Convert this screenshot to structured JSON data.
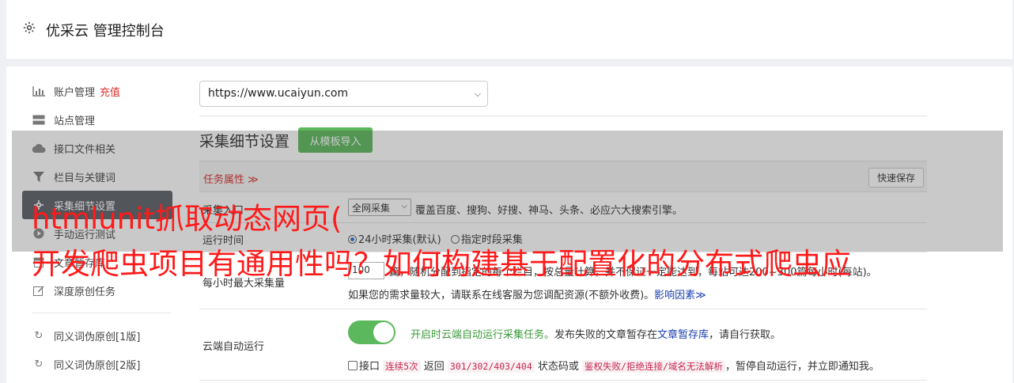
{
  "header": {
    "title": "优采云 管理控制台"
  },
  "sidebar": {
    "items": [
      {
        "label": "账户管理",
        "extra": "充值",
        "icon": "bar-chart-icon"
      },
      {
        "label": "站点管理",
        "icon": "server-icon"
      },
      {
        "label": "接口文件相关",
        "icon": "cloud-icon"
      },
      {
        "label": "栏目与关键词",
        "icon": "filter-icon"
      },
      {
        "label": "采集细节设置",
        "icon": "gear-icon",
        "active": true
      },
      {
        "label": "手动运行测试",
        "icon": "play-icon"
      },
      {
        "label": "文章暂存库",
        "icon": "archive-icon"
      },
      {
        "label": "深度原创任务",
        "icon": "edit-icon"
      },
      {
        "label": "同义词伪原创[1版]",
        "icon": "refresh-icon"
      },
      {
        "label": "同义词伪原创[2版]",
        "icon": "refresh-icon"
      }
    ]
  },
  "main": {
    "site_select": "https://www.ucaiyun.com",
    "section_title": "采集细节设置",
    "template_button": "从模板导入",
    "task_props": "任务属性 ≫",
    "quick_save": "快速保存",
    "source_label": "采集入口",
    "source_select": "全网采集",
    "source_desc": "覆盖百度、搜狗、好搜、神马、头条、必应六大搜索引擎。",
    "run_time_label": "运行时间",
    "run_time_opt1": "24小时采集(默认)",
    "run_time_opt2": "指定时段采集",
    "max_label": "每小时最大采集量",
    "max_value": "100",
    "max_desc": "篇，随机分配到指定的每个栏目，按总量计算，并不保证一定能达到，每站可达200~300篇每小时(每站)。",
    "max_note": "如果您的需求量较大，请联系在线客服为您调配资源(不额外收费)。",
    "max_link": "影响因素≫",
    "cloud_label": "云端自动运行",
    "cloud_on": "开启时云端自动运行采集任务。",
    "cloud_desc1": "发布失败的文章暂存在",
    "cloud_link": "文章暂存库",
    "cloud_desc2": "，请自行获取。",
    "api_prefix": "接口",
    "api_code1": "连续5次",
    "api_mid1": "返回",
    "api_code2": "301/302/403/404",
    "api_mid2": "状态码或",
    "api_code3": "鉴权失败/拒绝连接/域名无法解析",
    "api_suffix": "，暂停自动运行，并立即通知我。"
  },
  "overlay": {
    "line1": "htmlunit抓取动态网页(",
    "line2": "开发爬虫项目有通用性吗？如何构建基于配置化的分布式爬虫应"
  },
  "colors": {
    "accent_green": "#5cb85c",
    "accent_red": "#d9312e",
    "active_bg": "#5b5f66",
    "overlay_text": "#ff1a1a"
  }
}
